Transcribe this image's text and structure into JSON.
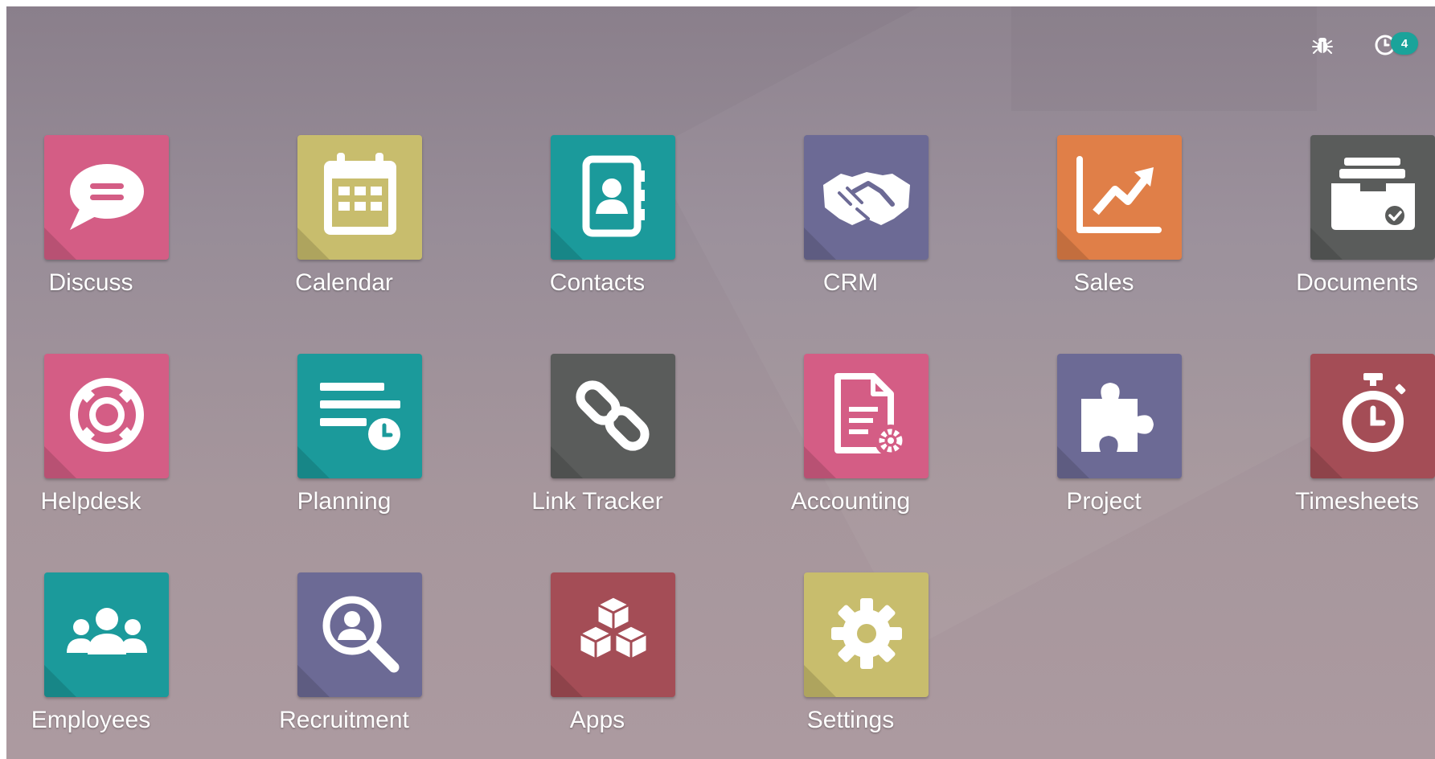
{
  "topbar": {
    "debug_icon": "bug-icon",
    "activity_icon": "clock-icon",
    "activity_count": "4"
  },
  "colors": {
    "background": "#988d98",
    "badge": "#1aa39a"
  },
  "apps": [
    {
      "label": "Discuss",
      "icon": "chat-bubble-icon",
      "color": "#d45d85"
    },
    {
      "label": "Calendar",
      "icon": "calendar-icon",
      "color": "#c8bd6d"
    },
    {
      "label": "Contacts",
      "icon": "address-book-icon",
      "color": "#1b9a9b"
    },
    {
      "label": "CRM",
      "icon": "handshake-icon",
      "color": "#6c6a95"
    },
    {
      "label": "Sales",
      "icon": "chart-up-icon",
      "color": "#e07f48"
    },
    {
      "label": "Documents",
      "icon": "inbox-tray-icon",
      "color": "#5a5c5b"
    },
    {
      "label": "Helpdesk",
      "icon": "life-ring-icon",
      "color": "#d45d85"
    },
    {
      "label": "Planning",
      "icon": "tasks-clock-icon",
      "color": "#1b9a9b"
    },
    {
      "label": "Link Tracker",
      "icon": "link-icon",
      "color": "#5a5c5b"
    },
    {
      "label": "Accounting",
      "icon": "invoice-gear-icon",
      "color": "#d45d85"
    },
    {
      "label": "Project",
      "icon": "puzzle-icon",
      "color": "#6c6a95"
    },
    {
      "label": "Timesheets",
      "icon": "stopwatch-icon",
      "color": "#a44d56"
    },
    {
      "label": "Employees",
      "icon": "users-icon",
      "color": "#1b9a9b"
    },
    {
      "label": "Recruitment",
      "icon": "search-person-icon",
      "color": "#6c6a95"
    },
    {
      "label": "Apps",
      "icon": "cubes-icon",
      "color": "#a44d56"
    },
    {
      "label": "Settings",
      "icon": "gear-icon",
      "color": "#c8bd6d"
    }
  ]
}
